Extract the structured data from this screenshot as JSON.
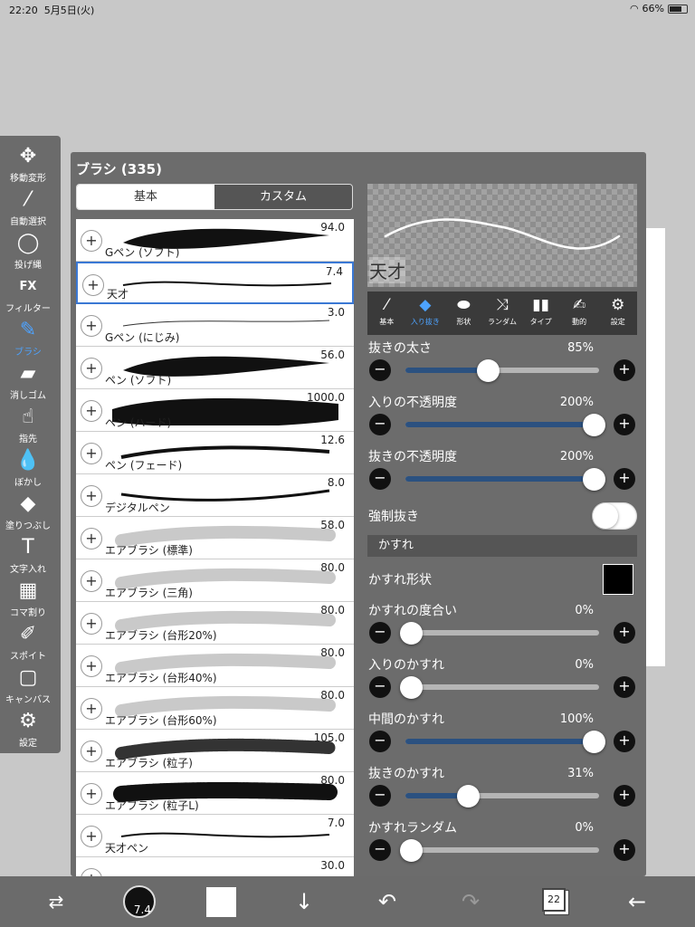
{
  "status": {
    "time": "22:20",
    "date": "5月5日(火)",
    "battery": "66%"
  },
  "tools": [
    {
      "id": "move",
      "label": "移動変形",
      "icon": "move-icon",
      "glyph": "✥"
    },
    {
      "id": "magic",
      "label": "自動選択",
      "icon": "magic-wand-icon",
      "glyph": "⁄"
    },
    {
      "id": "lasso",
      "label": "投げ縄",
      "icon": "lasso-icon",
      "glyph": "◯"
    },
    {
      "id": "fx",
      "label": "フィルター",
      "icon": "fx-icon",
      "glyph": "FX"
    },
    {
      "id": "brush",
      "label": "ブラシ",
      "icon": "brush-icon",
      "glyph": "✎",
      "active": true
    },
    {
      "id": "eraser",
      "label": "消しゴム",
      "icon": "eraser-icon",
      "glyph": "▰"
    },
    {
      "id": "smudge",
      "label": "指先",
      "icon": "finger-icon",
      "glyph": "☝"
    },
    {
      "id": "blur",
      "label": "ぼかし",
      "icon": "blur-drop-icon",
      "glyph": "💧"
    },
    {
      "id": "fill",
      "label": "塗りつぶし",
      "icon": "bucket-icon",
      "glyph": "◆"
    },
    {
      "id": "text",
      "label": "文字入れ",
      "icon": "text-icon",
      "glyph": "T"
    },
    {
      "id": "frame",
      "label": "コマ割り",
      "icon": "frame-divider-icon",
      "glyph": "▦"
    },
    {
      "id": "eyedrop",
      "label": "スポイト",
      "icon": "eyedropper-icon",
      "glyph": "✐"
    },
    {
      "id": "canvas",
      "label": "キャンバス",
      "icon": "canvas-icon",
      "glyph": "▢"
    },
    {
      "id": "settings",
      "label": "設定",
      "icon": "gear-icon",
      "glyph": "⚙"
    }
  ],
  "panel": {
    "title": "ブラシ (335)",
    "tabs": [
      {
        "label": "基本",
        "active": true
      },
      {
        "label": "カスタム",
        "active": false
      }
    ]
  },
  "brushes": [
    {
      "name": "Gペン (ソフト)",
      "size": "94.0",
      "stroke": "thick-taper"
    },
    {
      "name": "天才",
      "size": "7.4",
      "stroke": "thin-wave",
      "selected": true
    },
    {
      "name": "Gペン (にじみ)",
      "size": "3.0",
      "stroke": "hair"
    },
    {
      "name": "ペン (ソフト)",
      "size": "56.0",
      "stroke": "thick-taper"
    },
    {
      "name": "ペン (ハード)",
      "size": "1000.0",
      "stroke": "huge"
    },
    {
      "name": "ペン (フェード)",
      "size": "12.6",
      "stroke": "fade"
    },
    {
      "name": "デジタルペン",
      "size": "8.0",
      "stroke": "digital"
    },
    {
      "name": "エアブラシ (標準)",
      "size": "58.0",
      "stroke": "air"
    },
    {
      "name": "エアブラシ (三角)",
      "size": "80.0",
      "stroke": "air"
    },
    {
      "name": "エアブラシ (台形20%)",
      "size": "80.0",
      "stroke": "air"
    },
    {
      "name": "エアブラシ (台形40%)",
      "size": "80.0",
      "stroke": "air"
    },
    {
      "name": "エアブラシ (台形60%)",
      "size": "80.0",
      "stroke": "air"
    },
    {
      "name": "エアブラシ (粒子)",
      "size": "105.0",
      "stroke": "grain"
    },
    {
      "name": "エアブラシ (粒子L)",
      "size": "80.0",
      "stroke": "grain-l"
    },
    {
      "name": "天才ペン",
      "size": "7.0",
      "stroke": "thin-wave"
    },
    {
      "name": "",
      "size": "30.0",
      "stroke": "partial"
    }
  ],
  "preview": {
    "sample_text": "天才"
  },
  "setting_tabs": [
    {
      "label": "基本",
      "icon": "brush-icon",
      "glyph": "⁄"
    },
    {
      "label": "入り抜き",
      "icon": "diamond-icon",
      "glyph": "◆",
      "active": true
    },
    {
      "label": "形状",
      "icon": "ellipse-icon",
      "glyph": "⬬"
    },
    {
      "label": "ランダム",
      "icon": "shuffle-icon",
      "glyph": "⤨"
    },
    {
      "label": "タイプ",
      "icon": "type-icon",
      "glyph": "▮▮"
    },
    {
      "label": "動的",
      "icon": "dynamic-icon",
      "glyph": "✍"
    },
    {
      "label": "設定",
      "icon": "gear-icon",
      "glyph": "⚙"
    }
  ],
  "settings": {
    "out_thickness": {
      "label": "抜きの太さ",
      "value": "85%",
      "fraction": 0.42
    },
    "in_opacity": {
      "label": "入りの不透明度",
      "value": "200%",
      "fraction": 1.0
    },
    "out_opacity": {
      "label": "抜きの不透明度",
      "value": "200%",
      "fraction": 1.0
    },
    "force_out": {
      "label": "強制抜き",
      "on": false
    },
    "section_title": "かすれ",
    "scratch_shape": {
      "label": "かすれ形状"
    },
    "scratch_degree": {
      "label": "かすれの度合い",
      "value": "0%",
      "fraction": 0.0
    },
    "in_scratch": {
      "label": "入りのかすれ",
      "value": "0%",
      "fraction": 0.0
    },
    "mid_scratch": {
      "label": "中間のかすれ",
      "value": "100%",
      "fraction": 1.0
    },
    "out_scratch": {
      "label": "抜きのかすれ",
      "value": "31%",
      "fraction": 0.31
    },
    "scratch_random": {
      "label": "かすれランダム",
      "value": "0%",
      "fraction": 0.0
    }
  },
  "bottom": {
    "brush_size": "7.4",
    "layer_count": "22"
  }
}
